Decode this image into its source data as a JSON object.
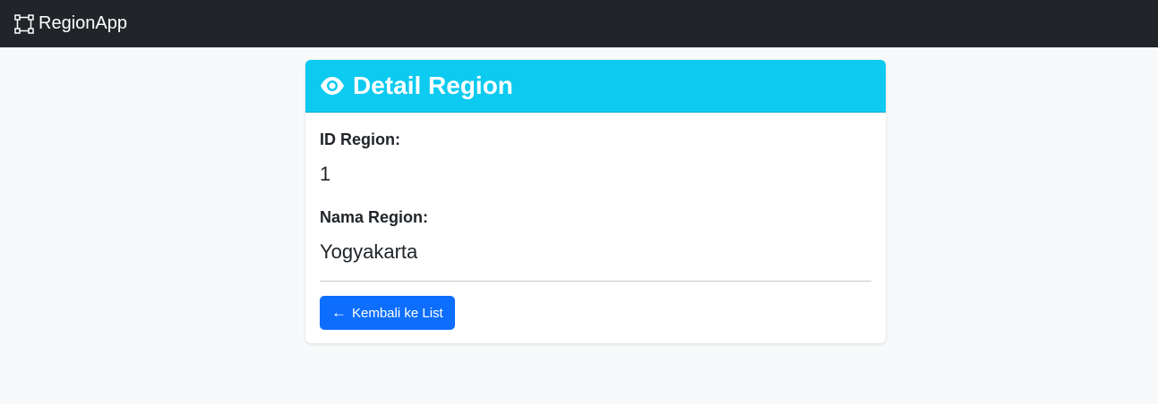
{
  "navbar": {
    "brand": "RegionApp",
    "brand_icon": "bounding-box-icon"
  },
  "card": {
    "header_icon": "eye-icon",
    "title": "Detail Region",
    "header_color": "#0dcaf0",
    "fields": [
      {
        "label": "ID Region:",
        "value": "1"
      },
      {
        "label": "Nama Region:",
        "value": "Yogyakarta"
      }
    ],
    "back_button": {
      "icon": "arrow-left-icon",
      "arrow": "←",
      "label": "Kembali ke List",
      "color": "#0d6efd"
    }
  }
}
